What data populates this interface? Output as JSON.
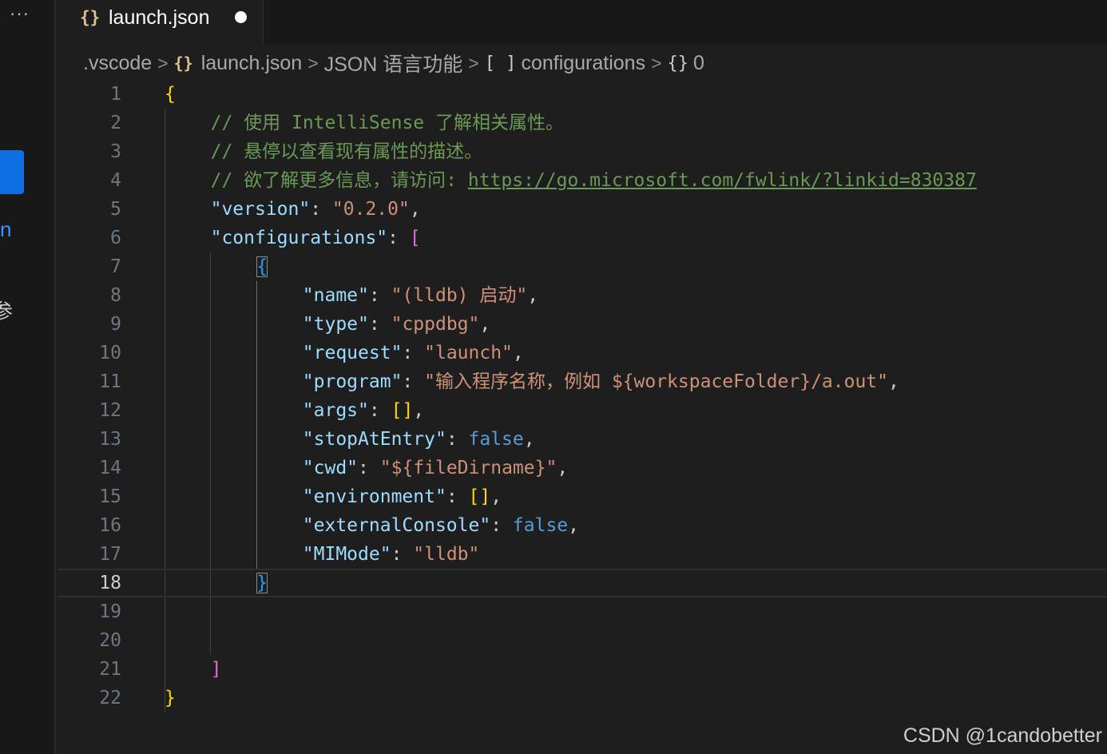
{
  "sidebar": {
    "more_label": "···",
    "partial_chars": [
      "n",
      "参"
    ]
  },
  "tab": {
    "icon": "{}",
    "label": "launch.json",
    "modified_indicator": "●"
  },
  "breadcrumb": {
    "items": [
      {
        "label": ".vscode"
      },
      {
        "icon": "{}",
        "label": "launch.json"
      },
      {
        "label": "JSON 语言功能"
      },
      {
        "icon": "[ ]",
        "label": "configurations"
      },
      {
        "icon": "{}",
        "label": "0"
      }
    ],
    "separator": ">"
  },
  "editor": {
    "active_line": 18,
    "line_numbers": [
      "1",
      "2",
      "3",
      "4",
      "5",
      "6",
      "7",
      "8",
      "9",
      "10",
      "11",
      "12",
      "13",
      "14",
      "15",
      "16",
      "17",
      "18",
      "19",
      "20",
      "21",
      "22"
    ],
    "lines": [
      [
        {
          "t": "{",
          "c": "brace-y"
        }
      ],
      [
        {
          "t": "// 使用 IntelliSense 了解相关属性。",
          "c": "comment"
        }
      ],
      [
        {
          "t": "// 悬停以查看现有属性的描述。",
          "c": "comment"
        }
      ],
      [
        {
          "t": "// 欲了解更多信息，请访问: ",
          "c": "comment"
        },
        {
          "t": "https://go.microsoft.com/fwlink/?linkid=830387",
          "c": "link"
        }
      ],
      [
        {
          "t": "\"version\"",
          "c": "key"
        },
        {
          "t": ": ",
          "c": "punc"
        },
        {
          "t": "\"0.2.0\"",
          "c": "str"
        },
        {
          "t": ",",
          "c": "punc"
        }
      ],
      [
        {
          "t": "\"configurations\"",
          "c": "key"
        },
        {
          "t": ": ",
          "c": "punc"
        },
        {
          "t": "[",
          "c": "brace-p"
        }
      ],
      [
        {
          "t": "{",
          "c": "brace-b match"
        }
      ],
      [
        {
          "t": "\"name\"",
          "c": "key"
        },
        {
          "t": ": ",
          "c": "punc"
        },
        {
          "t": "\"(lldb) 启动\"",
          "c": "str"
        },
        {
          "t": ",",
          "c": "punc"
        }
      ],
      [
        {
          "t": "\"type\"",
          "c": "key"
        },
        {
          "t": ": ",
          "c": "punc"
        },
        {
          "t": "\"cppdbg\"",
          "c": "str"
        },
        {
          "t": ",",
          "c": "punc"
        }
      ],
      [
        {
          "t": "\"request\"",
          "c": "key"
        },
        {
          "t": ": ",
          "c": "punc"
        },
        {
          "t": "\"launch\"",
          "c": "str"
        },
        {
          "t": ",",
          "c": "punc"
        }
      ],
      [
        {
          "t": "\"program\"",
          "c": "key"
        },
        {
          "t": ": ",
          "c": "punc"
        },
        {
          "t": "\"输入程序名称，例如 ${workspaceFolder}/a.out\"",
          "c": "str"
        },
        {
          "t": ",",
          "c": "punc"
        }
      ],
      [
        {
          "t": "\"args\"",
          "c": "key"
        },
        {
          "t": ": ",
          "c": "punc"
        },
        {
          "t": "[]",
          "c": "brace-y"
        },
        {
          "t": ",",
          "c": "punc"
        }
      ],
      [
        {
          "t": "\"stopAtEntry\"",
          "c": "key"
        },
        {
          "t": ": ",
          "c": "punc"
        },
        {
          "t": "false",
          "c": "bool"
        },
        {
          "t": ",",
          "c": "punc"
        }
      ],
      [
        {
          "t": "\"cwd\"",
          "c": "key"
        },
        {
          "t": ": ",
          "c": "punc"
        },
        {
          "t": "\"${fileDirname}\"",
          "c": "str"
        },
        {
          "t": ",",
          "c": "punc"
        }
      ],
      [
        {
          "t": "\"environment\"",
          "c": "key"
        },
        {
          "t": ": ",
          "c": "punc"
        },
        {
          "t": "[]",
          "c": "brace-y"
        },
        {
          "t": ",",
          "c": "punc"
        }
      ],
      [
        {
          "t": "\"externalConsole\"",
          "c": "key"
        },
        {
          "t": ": ",
          "c": "punc"
        },
        {
          "t": "false",
          "c": "bool"
        },
        {
          "t": ",",
          "c": "punc"
        }
      ],
      [
        {
          "t": "\"MIMode\"",
          "c": "key"
        },
        {
          "t": ": ",
          "c": "punc"
        },
        {
          "t": "\"lldb\"",
          "c": "str"
        }
      ],
      [
        {
          "t": "}",
          "c": "brace-b match"
        }
      ],
      [],
      [],
      [
        {
          "t": "]",
          "c": "brace-p"
        }
      ],
      [
        {
          "t": "}",
          "c": "brace-y"
        }
      ]
    ]
  },
  "watermark": "CSDN @1candobetter",
  "colors": {
    "background": "#1e1e1e",
    "comment": "#6a9955",
    "key": "#9cdcfe",
    "string": "#ce9178",
    "boolean": "#569cd6",
    "bracket_level1": "#ffd700",
    "bracket_level2": "#da70d6",
    "bracket_level3": "#179fff",
    "accent": "#0e70e0"
  }
}
